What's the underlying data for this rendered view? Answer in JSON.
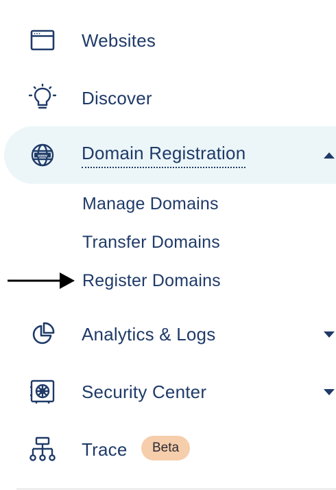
{
  "nav": {
    "websites": {
      "label": "Websites",
      "icon": "browser-window-icon"
    },
    "discover": {
      "label": "Discover",
      "icon": "lightbulb-icon"
    },
    "domain_registration": {
      "label": "Domain Registration",
      "icon": "globe-www-icon",
      "expanded": true,
      "sub_items": [
        {
          "label": "Manage Domains"
        },
        {
          "label": "Transfer Domains"
        },
        {
          "label": "Register Domains"
        }
      ]
    },
    "analytics": {
      "label": "Analytics & Logs",
      "icon": "pie-chart-icon"
    },
    "security": {
      "label": "Security Center",
      "icon": "safe-vault-icon"
    },
    "trace": {
      "label": "Trace",
      "icon": "network-tree-icon",
      "badge": "Beta"
    }
  },
  "colors": {
    "text": "#1f3a68",
    "active_bg": "#ecf6f8",
    "badge_bg": "#f6ceab"
  }
}
